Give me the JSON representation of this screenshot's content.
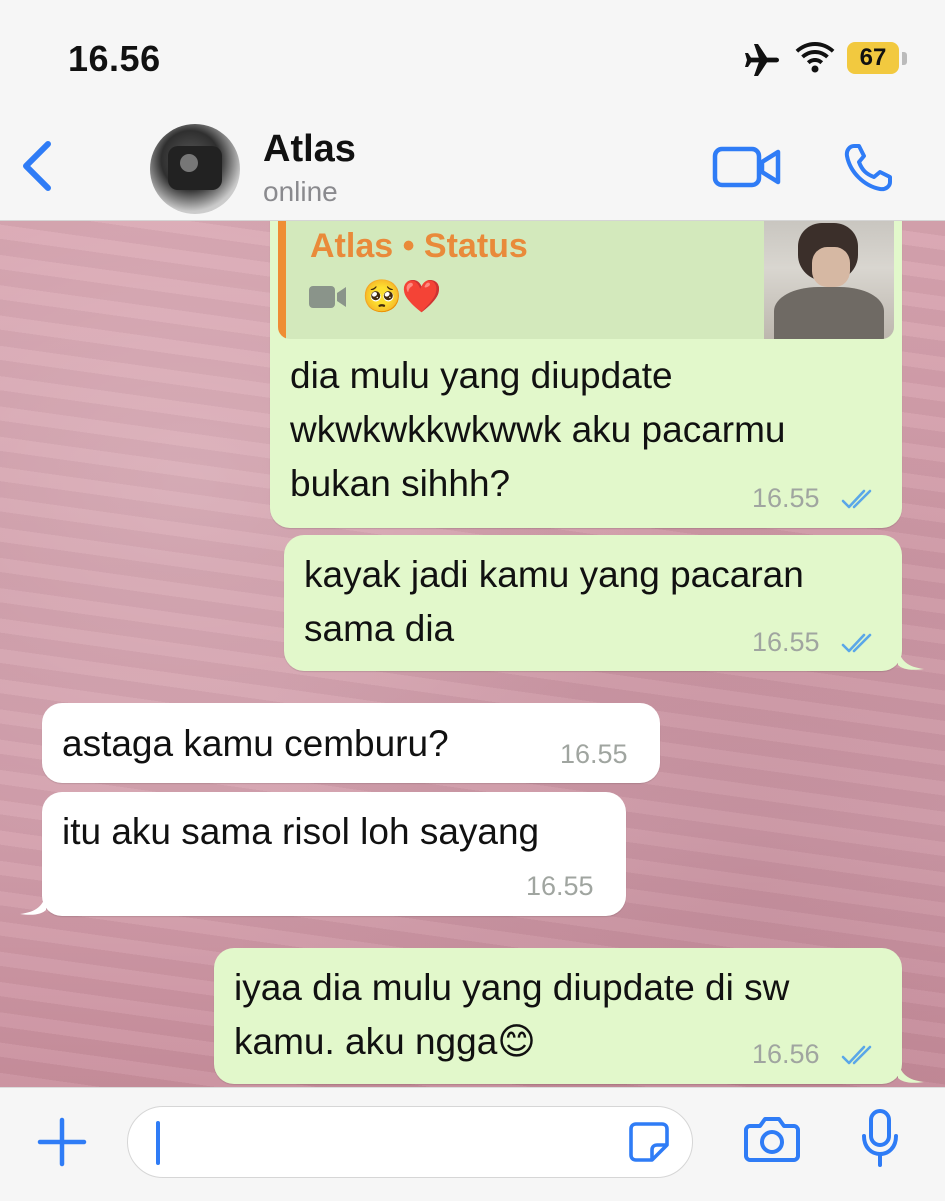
{
  "status_bar": {
    "time": "16.56",
    "battery": "67"
  },
  "header": {
    "name": "Atlas",
    "status": "online"
  },
  "quote": {
    "title": "Atlas • Status",
    "emoji": "🥺❤️"
  },
  "messages": [
    {
      "direction": "outgoing",
      "lines": [
        "dia mulu yang diupdate",
        "wkwkwkkwkwwk aku pacarmu",
        "bukan sihhh?"
      ],
      "time": "16.55",
      "read": true
    },
    {
      "direction": "outgoing",
      "lines": [
        "kayak jadi kamu yang pacaran",
        "sama dia"
      ],
      "time": "16.55",
      "read": true
    },
    {
      "direction": "incoming",
      "lines": [
        "astaga kamu cemburu?"
      ],
      "time": "16.55"
    },
    {
      "direction": "incoming",
      "lines": [
        "itu aku sama risol loh sayang"
      ],
      "time": "16.55"
    },
    {
      "direction": "outgoing",
      "lines": [
        "iyaa dia mulu yang diupdate di sw",
        "kamu. aku ngga😊"
      ],
      "time": "16.56",
      "read": true
    }
  ],
  "colors": {
    "accent": "#2f7cf6",
    "outgoing_bubble": "#e2f8cb",
    "incoming_bubble": "#ffffff",
    "quote_name": "#e98a3a",
    "read_ticks": "#5aa7e8"
  },
  "icons": [
    "airplane-icon",
    "wifi-icon",
    "back-chevron-icon",
    "video-call-icon",
    "phone-icon",
    "video-camera-icon",
    "plus-icon",
    "sticker-icon",
    "camera-icon",
    "microphone-icon"
  ]
}
